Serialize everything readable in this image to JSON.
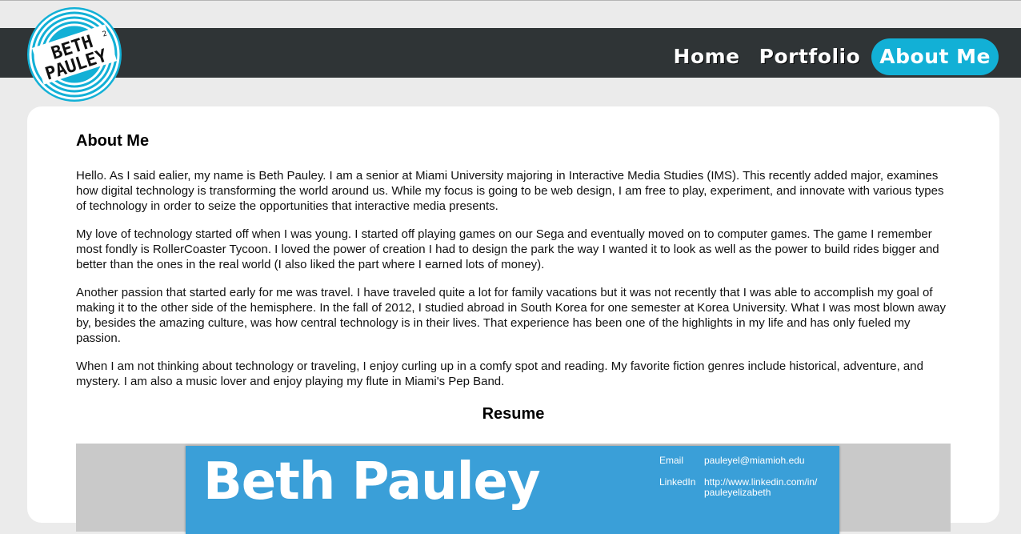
{
  "brand": {
    "logo_text_line1": "BETH",
    "logo_text_line2": "PAULEY",
    "logo_mark": "2"
  },
  "nav": {
    "items": [
      {
        "label": "Home",
        "active": false
      },
      {
        "label": "Portfolio",
        "active": false
      },
      {
        "label": "About Me",
        "active": true
      }
    ]
  },
  "main": {
    "title": "About Me",
    "paragraphs": [
      "Hello. As I said ealier, my name is Beth Pauley. I am a senior at Miami University majoring in Interactive Media Studies (IMS). This recently added major, examines how digital technology is transforming the world around us. While my focus is going to be web design, I am free to play, experiment, and innovate with various types of technology in order to seize the opportunities that interactive media presents.",
      "My love of technology started off when I was young. I started off playing games on our Sega and eventually moved on to computer games. The game I remember most fondly is RollerCoaster Tycoon. I loved the power of creation I had to design the park the way I wanted it to look as well as the power to build rides bigger and better than the ones in the real world (I also liked the part where I earned lots of money).",
      "Another passion that started early for me was travel. I have traveled quite a lot for family vacations but it was not recently that I was able to accomplish my goal of making it to the other side of the hemisphere. In the fall of 2012, I studied abroad in South Korea for one semester at Korea University. What I was most blown away by, besides the amazing culture, was how central technology is in their lives. That experience has been one of the highlights in my life and has only fueled my passion.",
      "When I am not thinking about technology or traveling, I enjoy curling up in a comfy spot and reading. My favorite fiction genres include historical, adventure, and mystery. I am also a music lover and enjoy playing my flute in Miami's Pep Band."
    ],
    "resume_heading": "Resume"
  },
  "resume": {
    "name": "Beth Pauley",
    "email_label": "Email",
    "email_value": "pauleyel@miamioh.edu",
    "linkedin_label": "LinkedIn",
    "linkedin_line1": "http://www.linkedin.com/in/",
    "linkedin_line2": "pauleyelizabeth"
  },
  "colors": {
    "accent": "#12b0d6",
    "navbar": "#2f3436",
    "page_bg": "#ebebeb",
    "resume_blue": "#3a9fd8"
  }
}
